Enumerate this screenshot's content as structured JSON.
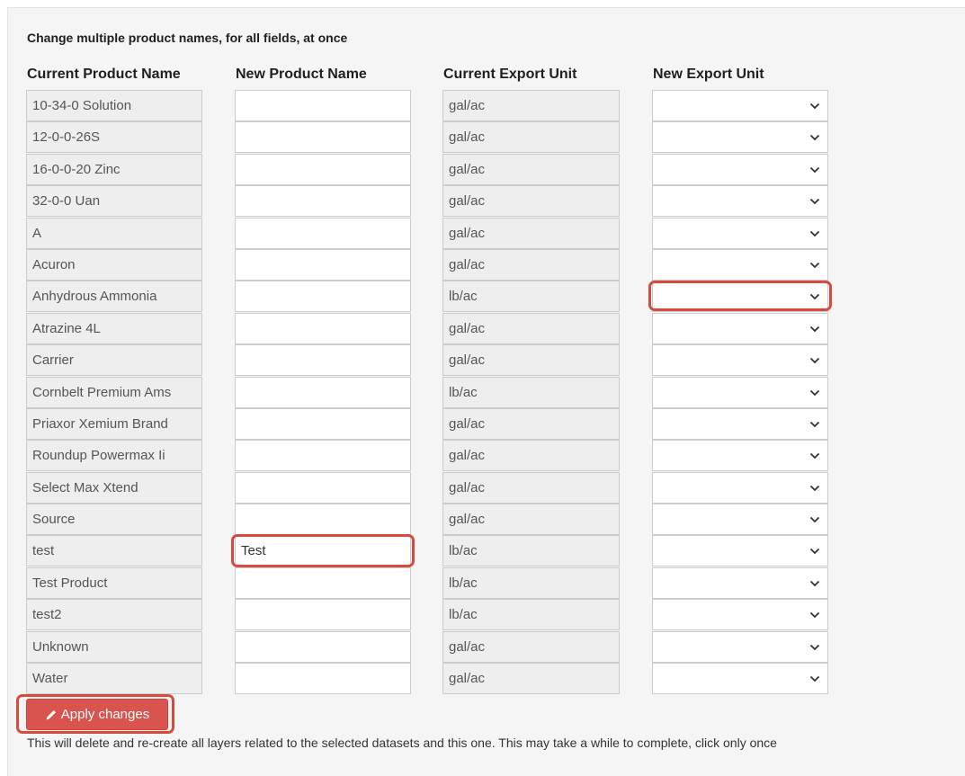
{
  "form": {
    "heading": "Change multiple product names, for all fields, at once",
    "columns": {
      "current_name": "Current Product Name",
      "new_name": "New Product Name",
      "current_unit": "Current Export Unit",
      "new_unit": "New Export Unit"
    },
    "rows": [
      {
        "current_name": "10-34-0 Solution",
        "new_name": "",
        "current_unit": "gal/ac",
        "new_unit": ""
      },
      {
        "current_name": "12-0-0-26S",
        "new_name": "",
        "current_unit": "gal/ac",
        "new_unit": ""
      },
      {
        "current_name": "16-0-0-20 Zinc",
        "new_name": "",
        "current_unit": "gal/ac",
        "new_unit": ""
      },
      {
        "current_name": "32-0-0 Uan",
        "new_name": "",
        "current_unit": "gal/ac",
        "new_unit": ""
      },
      {
        "current_name": "A",
        "new_name": "",
        "current_unit": "gal/ac",
        "new_unit": ""
      },
      {
        "current_name": "Acuron",
        "new_name": "",
        "current_unit": "gal/ac",
        "new_unit": ""
      },
      {
        "current_name": "Anhydrous Ammonia",
        "new_name": "",
        "current_unit": "lb/ac",
        "new_unit": ""
      },
      {
        "current_name": "Atrazine 4L",
        "new_name": "",
        "current_unit": "gal/ac",
        "new_unit": ""
      },
      {
        "current_name": "Carrier",
        "new_name": "",
        "current_unit": "gal/ac",
        "new_unit": ""
      },
      {
        "current_name": "Cornbelt Premium Ams",
        "new_name": "",
        "current_unit": "lb/ac",
        "new_unit": ""
      },
      {
        "current_name": "Priaxor Xemium Brand",
        "new_name": "",
        "current_unit": "gal/ac",
        "new_unit": ""
      },
      {
        "current_name": "Roundup Powermax Ii",
        "new_name": "",
        "current_unit": "gal/ac",
        "new_unit": ""
      },
      {
        "current_name": "Select Max Xtend",
        "new_name": "",
        "current_unit": "gal/ac",
        "new_unit": ""
      },
      {
        "current_name": "Source",
        "new_name": "",
        "current_unit": "gal/ac",
        "new_unit": ""
      },
      {
        "current_name": "test",
        "new_name": "Test",
        "current_unit": "lb/ac",
        "new_unit": ""
      },
      {
        "current_name": "Test Product",
        "new_name": "",
        "current_unit": "lb/ac",
        "new_unit": ""
      },
      {
        "current_name": "test2",
        "new_name": "",
        "current_unit": "lb/ac",
        "new_unit": ""
      },
      {
        "current_name": "Unknown",
        "new_name": "",
        "current_unit": "gal/ac",
        "new_unit": ""
      },
      {
        "current_name": "Water",
        "new_name": "",
        "current_unit": "gal/ac",
        "new_unit": ""
      }
    ],
    "apply_label": "Apply changes",
    "footnote": "This will delete and re-create all layers related to the selected datasets and this one. This may take a while to complete, click only once"
  },
  "icons": {
    "dropdown": "chevron-down-icon",
    "apply": "pencil-icon"
  },
  "colors": {
    "danger": "#d9534f",
    "highlight": "#d64b3e",
    "panel": "#f5f5f5",
    "readonly": "#eeeeee"
  }
}
